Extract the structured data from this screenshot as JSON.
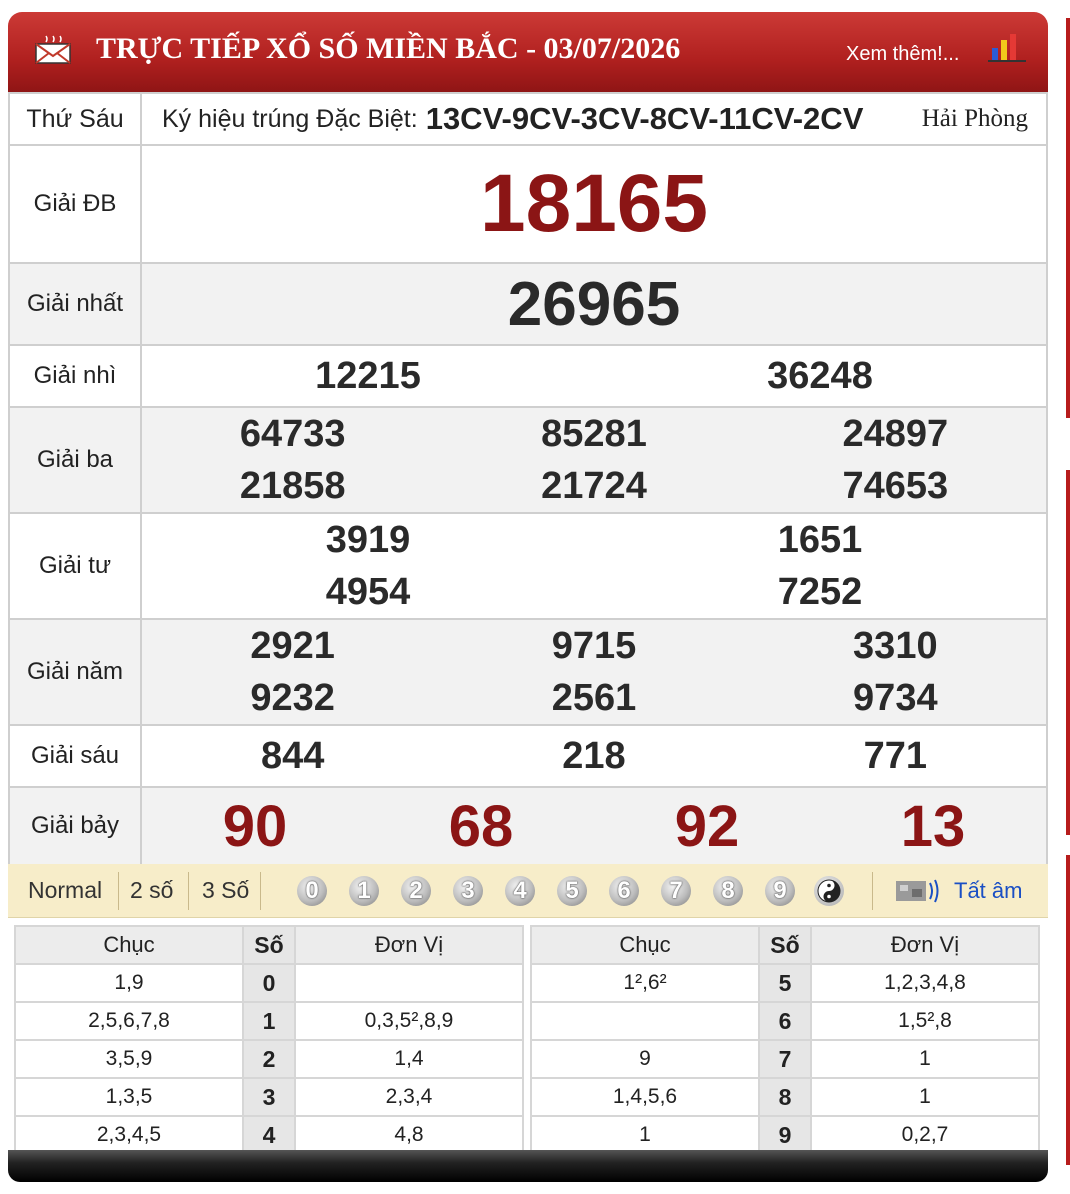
{
  "header": {
    "title": "TRỰC TIẾP XỔ SỐ MIỀN BẮC - 03/07/2026",
    "more_link": "Xem thêm!...",
    "icons": [
      "mail-icon",
      "bar-chart-icon"
    ]
  },
  "info_row": {
    "weekday": "Thứ Sáu",
    "code_label": "Ký hiệu trúng Đặc Biệt:",
    "code_value": "13CV-9CV-3CV-8CV-11CV-2CV",
    "city": "Hải Phòng"
  },
  "prizes": {
    "db": {
      "label": "Giải ĐB",
      "numbers": [
        "18165"
      ]
    },
    "g1": {
      "label": "Giải nhất",
      "numbers": [
        "26965"
      ]
    },
    "g2": {
      "label": "Giải nhì",
      "numbers": [
        "12215",
        "36248"
      ]
    },
    "g3": {
      "label": "Giải ba",
      "numbers": [
        "64733",
        "85281",
        "24897",
        "21858",
        "21724",
        "74653"
      ]
    },
    "g4": {
      "label": "Giải tư",
      "numbers": [
        "3919",
        "1651",
        "4954",
        "7252"
      ]
    },
    "g5": {
      "label": "Giải năm",
      "numbers": [
        "2921",
        "9715",
        "3310",
        "9232",
        "2561",
        "9734"
      ]
    },
    "g6": {
      "label": "Giải sáu",
      "numbers": [
        "844",
        "218",
        "771"
      ]
    },
    "g7": {
      "label": "Giải bảy",
      "numbers": [
        "90",
        "68",
        "92",
        "13"
      ]
    }
  },
  "toolbar": {
    "modes": [
      "Normal",
      "2 số",
      "3 Số"
    ],
    "digits": [
      "0",
      "1",
      "2",
      "3",
      "4",
      "5",
      "6",
      "7",
      "8",
      "9"
    ],
    "mute_label": "Tất âm",
    "icons": [
      "yin-yang-icon",
      "sound-icon"
    ]
  },
  "loto": {
    "headers": {
      "chuc": "Chục",
      "so": "Số",
      "don_vi": "Đơn Vị"
    },
    "rows": [
      {
        "chuc": "1,9",
        "so": "0",
        "don_vi": ""
      },
      {
        "chuc": "2,5,6,7,8",
        "so": "1",
        "don_vi": "0,3,5²,8,9"
      },
      {
        "chuc": "3,5,9",
        "so": "2",
        "don_vi": "1,4"
      },
      {
        "chuc": "1,3,5",
        "so": "3",
        "don_vi": "2,3,4"
      },
      {
        "chuc": "2,3,4,5",
        "so": "4",
        "don_vi": "4,8"
      },
      {
        "chuc": "1²,6²",
        "so": "5",
        "don_vi": "1,2,3,4,8"
      },
      {
        "chuc": "",
        "so": "6",
        "don_vi": "1,5²,8"
      },
      {
        "chuc": "9",
        "so": "7",
        "don_vi": "1"
      },
      {
        "chuc": "1,4,5,6",
        "so": "8",
        "don_vi": "1"
      },
      {
        "chuc": "1",
        "so": "9",
        "don_vi": "0,2,7"
      }
    ]
  },
  "colors": {
    "header_red": "#b0201f",
    "number_red": "#8b1515",
    "toolbar_bg": "#f7edc9",
    "link_blue": "#1a4fc4"
  }
}
